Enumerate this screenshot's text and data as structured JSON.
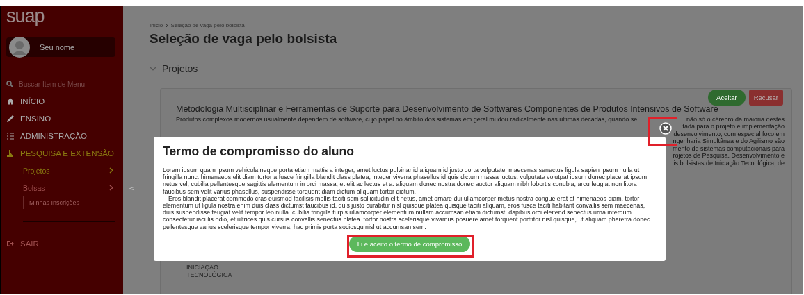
{
  "sidebar": {
    "logo": "suap",
    "user_name": "Seu nome",
    "search_placeholder": "Buscar Item de Menu",
    "menu": [
      {
        "label": "INÍCIO",
        "selected": false
      },
      {
        "label": "ENSINO",
        "selected": false
      },
      {
        "label": "ADMINISTRAÇÃO",
        "selected": false
      },
      {
        "label": "PESQUISA E EXTENSÃO",
        "selected": true,
        "children": [
          {
            "label": "Projetos",
            "selected": true,
            "has_submenu": true
          },
          {
            "label": "Bolsas",
            "selected": false,
            "has_submenu": true,
            "children": [
              {
                "label": "Minhas Inscrições"
              }
            ]
          }
        ]
      },
      {
        "label": "SAIR",
        "selected": false
      }
    ],
    "collapse_symbol": "<"
  },
  "breadcrumb": [
    "Início",
    "Seleção de vaga pelo bolsista"
  ],
  "breadcrumb_separator": "›",
  "page_title": "Seleção de vaga pelo bolsista",
  "section": {
    "title": "Projetos",
    "expanded": true
  },
  "project": {
    "actions": [
      {
        "label": "Aceitar",
        "kind": "accept"
      },
      {
        "label": "Recusar",
        "kind": "reject"
      }
    ],
    "title": "Metodologia Multisciplinar e Ferramentas de Suporte para Desenvolvimento de Softwares Componentes de Produtos Intensivos de Software",
    "description_first_line": "Produtos complexos modernos usualmente dependem de software, cujo papel no âmbito dos sistemas em geral mudou radicalmente nas últimas décadas, quando se",
    "description_first_line_end": "não só o cérebro da maioria destes",
    "description_visible_fragments": [
      "tada para o projeto e implementação",
      "desenvolvimento, com especial foco em",
      "ngenharia Simultânea e do Agilismo são",
      "mento de sistemas computacionais para",
      "rojetos de Pesquisa. Desenvolvimento e",
      "is bolsistas de Iniciação Tecnológica, de"
    ],
    "category": "INICIAÇÃO TECNOLÓGICA"
  },
  "modal": {
    "title": "Termo de compromisso do aluno",
    "paragraphs": [
      "Lorem ipsum quam ipsum vehicula neque porta etiam mattis a integer, amet luctus pulvinar id aliquam id justo porta vulputate, maecenas senectus ligula sapien ipsum nulla ut fringilla nunc. himenaeos elit diam tortor a fusce fringilla blandit class platea, integer viverra phasellus id quis dictum massa luctus. vulputate volutpat ipsum donec placerat ipsum netus vel, cubilia pellentesque sagittis elementum in orci massa, et elit ac lectus et a. aliquam donec nostra donec auctor aliquam nibh lobortis conubia, arcu feugiat non litora faucibus sem velit varius phasellus, suspendisse torquent diam dictum aliquam tortor dictum.",
      "Eros blandit placerat commodo cras euismod facilisis mollis taciti sem sollicitudin elit netus, amet ornare dui ullamcorper metus nostra congue erat at himenaeos diam, tortor elementum ut ligula nostra enim duis class dictumst faucibus id. quis justo curabitur nisl quisque platea quisque taciti aliquam, eros fusce taciti habitant convallis sem maecenas, duis suspendisse feugiat velit tempor leo nulla. cubilia fringilla turpis ullamcorper elementum nullam accumsan etiam dictumst, dapibus orci eleifend senectus urna interdum consectetur iaculis odio, et ultrices quis cursus convallis senectus platea. tortor nostra scelerisque vivamus posuere amet torquent porttitor nisl quisque, ut aliquam pharetra donec pellentesque varius scelerisque tempor viverra, hac primis porta sociosqu nisl ut accumsan sem."
    ],
    "accept_button": "Li e aceito o termo de compromisso"
  }
}
